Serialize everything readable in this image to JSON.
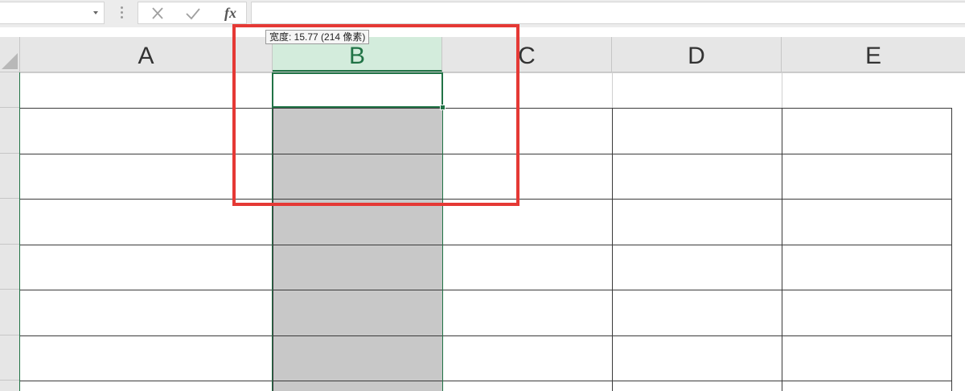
{
  "formula_bar": {
    "name_box_value": "",
    "cancel_icon": "x-icon",
    "enter_icon": "checkmark-icon",
    "function_label": "fx",
    "formula_value": ""
  },
  "columns": [
    {
      "label": "A",
      "selected": false
    },
    {
      "label": "B",
      "selected": true
    },
    {
      "label": "C",
      "selected": false
    },
    {
      "label": "D",
      "selected": false
    },
    {
      "label": "E",
      "selected": false
    }
  ],
  "tooltip": {
    "text": "宽度: 15.77 (214 像素)"
  },
  "colors": {
    "selection_accent": "#217346",
    "selected_header_bg": "#d3ecdc",
    "highlight_box": "#e53935",
    "selected_fill": "#c8c8c8"
  }
}
